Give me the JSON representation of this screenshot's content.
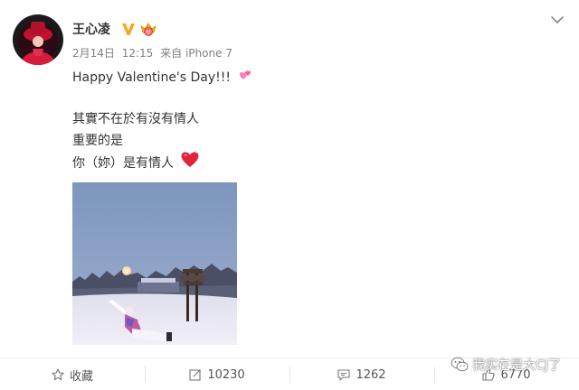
{
  "user": {
    "name": "王心凌",
    "avatar": "avatar-photo",
    "vip_badge_icon": "verified-v-icon",
    "crown_badge_icon": "crown-badge-icon"
  },
  "meta": {
    "date": "2月14日",
    "time": "12:15",
    "source": "来自 iPhone 7"
  },
  "post": {
    "line1": "Happy Valentine's Day!!!",
    "line1_icon": "sparkling-hearts-icon",
    "line2": "其實不在於有沒有情人",
    "line3": "重要的是",
    "line4": "你（妳）是有情人",
    "line4_icon": "red-heart-icon",
    "photo": "snow-landscape-photo"
  },
  "actions": {
    "favorite_label": "收藏",
    "repost_count": "10230",
    "comment_count": "1262",
    "like_count": "6770"
  },
  "watermark": {
    "text": "我实在是大CJ了",
    "icon": "wechat-icon"
  },
  "colors": {
    "accent_orange": "#f39c12",
    "heart_red": "#e0245e",
    "text": "#333333",
    "meta": "#808080"
  }
}
